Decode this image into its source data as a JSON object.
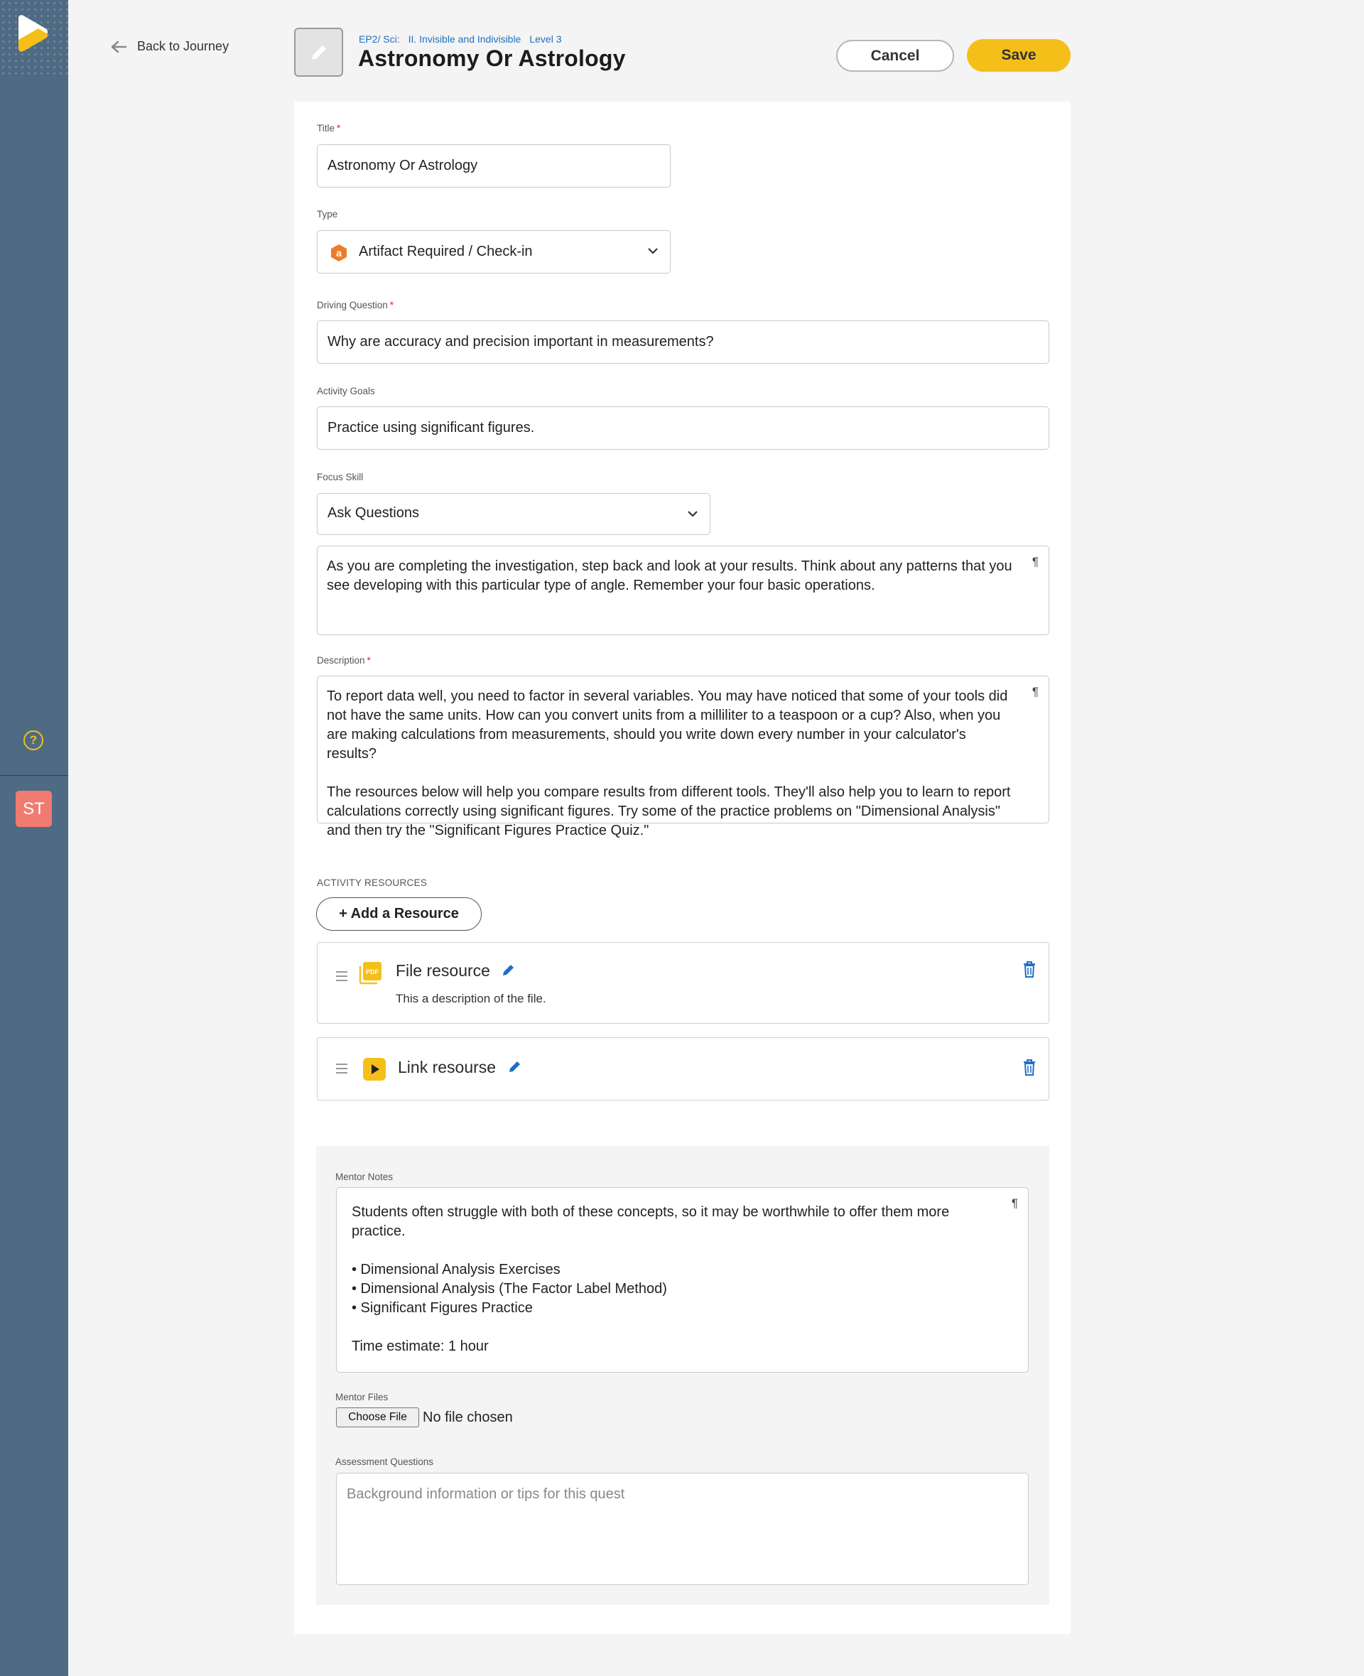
{
  "sidebar": {
    "help_label": "?",
    "avatar_initials": "ST"
  },
  "header": {
    "back_label": "Back to Journey",
    "breadcrumb": {
      "path": "EP2/ Sci:",
      "section": "II. Invisible and Indivisible",
      "level": "Level 3"
    },
    "title": "Astronomy Or Astrology",
    "cancel_label": "Cancel",
    "save_label": "Save"
  },
  "form": {
    "title": {
      "label": "Title",
      "required": "*",
      "value": "Astronomy Or Astrology"
    },
    "type": {
      "label": "Type",
      "value": "Artifact Required / Check-in",
      "icon": "artifact-hexagon-icon",
      "icon_letter": "a"
    },
    "driving_question": {
      "label": "Driving Question",
      "required": "*",
      "value": "Why are accuracy and precision important in measurements?"
    },
    "activity_goals": {
      "label": "Activity Goals",
      "value": "Practice using significant figures."
    },
    "focus_skill": {
      "label": "Focus Skill",
      "value": "Ask Questions",
      "note": "As you are completing the investigation, step back and look at your results. Think about any patterns that you see developing with this particular type of angle. Remember your four basic operations."
    },
    "description": {
      "label": "Description",
      "required": "*",
      "paragraph1": "To report data well, you need to factor in several variables. You may have noticed that some of your tools did not have the same units. How can you convert units from a milliliter to a teaspoon or a cup? Also, when you are making calculations from measurements, should you write down every number in your calculator's results?",
      "paragraph2": "The resources below will help you compare results from different tools. They'll also help you to learn to report calculations correctly using significant figures. Try some of the practice problems on \"Dimensional Analysis\" and then try the \"Significant Figures Practice Quiz.\""
    },
    "paragraph_mark": "¶",
    "resources": {
      "label": "ACTIVITY RESOURCES",
      "add_label": "+ Add a Resource",
      "items": [
        {
          "title": "File resource",
          "description": "This a description of the file.",
          "icon": "pdf-file-icon",
          "icon_text": "PDF"
        },
        {
          "title": "Link resourse",
          "icon": "play-video-icon"
        }
      ]
    },
    "mentor": {
      "notes_label": "Mentor Notes",
      "notes_intro": "Students often struggle with both of these concepts, so it may be worthwhile to offer them more practice.",
      "notes_items": [
        "• Dimensional Analysis Exercises",
        "• Dimensional Analysis (The Factor Label Method)",
        "• Significant Figures Practice"
      ],
      "time_estimate": "Time estimate: 1 hour",
      "files_label": "Mentor Files",
      "choose_file_label": "Choose File",
      "no_file_text": "No file chosen",
      "assessment_label": "Assessment Questions",
      "assessment_placeholder": "Background information or tips for this quest"
    }
  },
  "colors": {
    "sidebar": "#4f6a83",
    "accent": "#f5bf1a",
    "link": "#1f6fc2",
    "required": "#dd2222",
    "avatar": "#f07b71",
    "type_icon": "#ee7d2b"
  }
}
